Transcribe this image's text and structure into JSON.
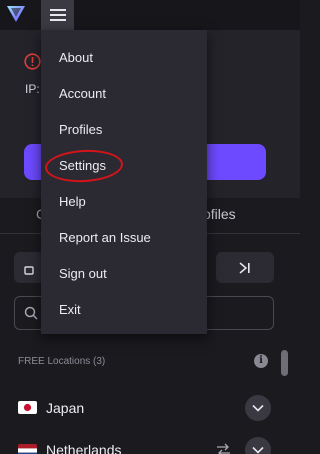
{
  "app": {
    "colors": {
      "accent": "#6d4aff",
      "annotation": "#d3141a",
      "warning": "#e0403d"
    }
  },
  "titlebar": {
    "logo_icon": "vpn-logo-icon",
    "menu_icon": "hamburger-menu-icon"
  },
  "connection": {
    "ip_label": "IP:",
    "warning_icon": "alert-circle-icon"
  },
  "tabs": {
    "left_partial": "C",
    "right_partial": "ofiles"
  },
  "menu": {
    "items": [
      {
        "label": "About"
      },
      {
        "label": "Account"
      },
      {
        "label": "Profiles"
      },
      {
        "label": "Settings",
        "highlighted": true
      },
      {
        "label": "Help"
      },
      {
        "label": "Report an Issue"
      },
      {
        "label": "Sign out"
      },
      {
        "label": "Exit"
      }
    ]
  },
  "search": {
    "placeholder": ""
  },
  "locations": {
    "header": "FREE Locations (3)",
    "items": [
      {
        "name": "Japan",
        "flag": "flag-japan-icon"
      },
      {
        "name": "Netherlands",
        "flag": "flag-netherlands-icon"
      }
    ]
  }
}
